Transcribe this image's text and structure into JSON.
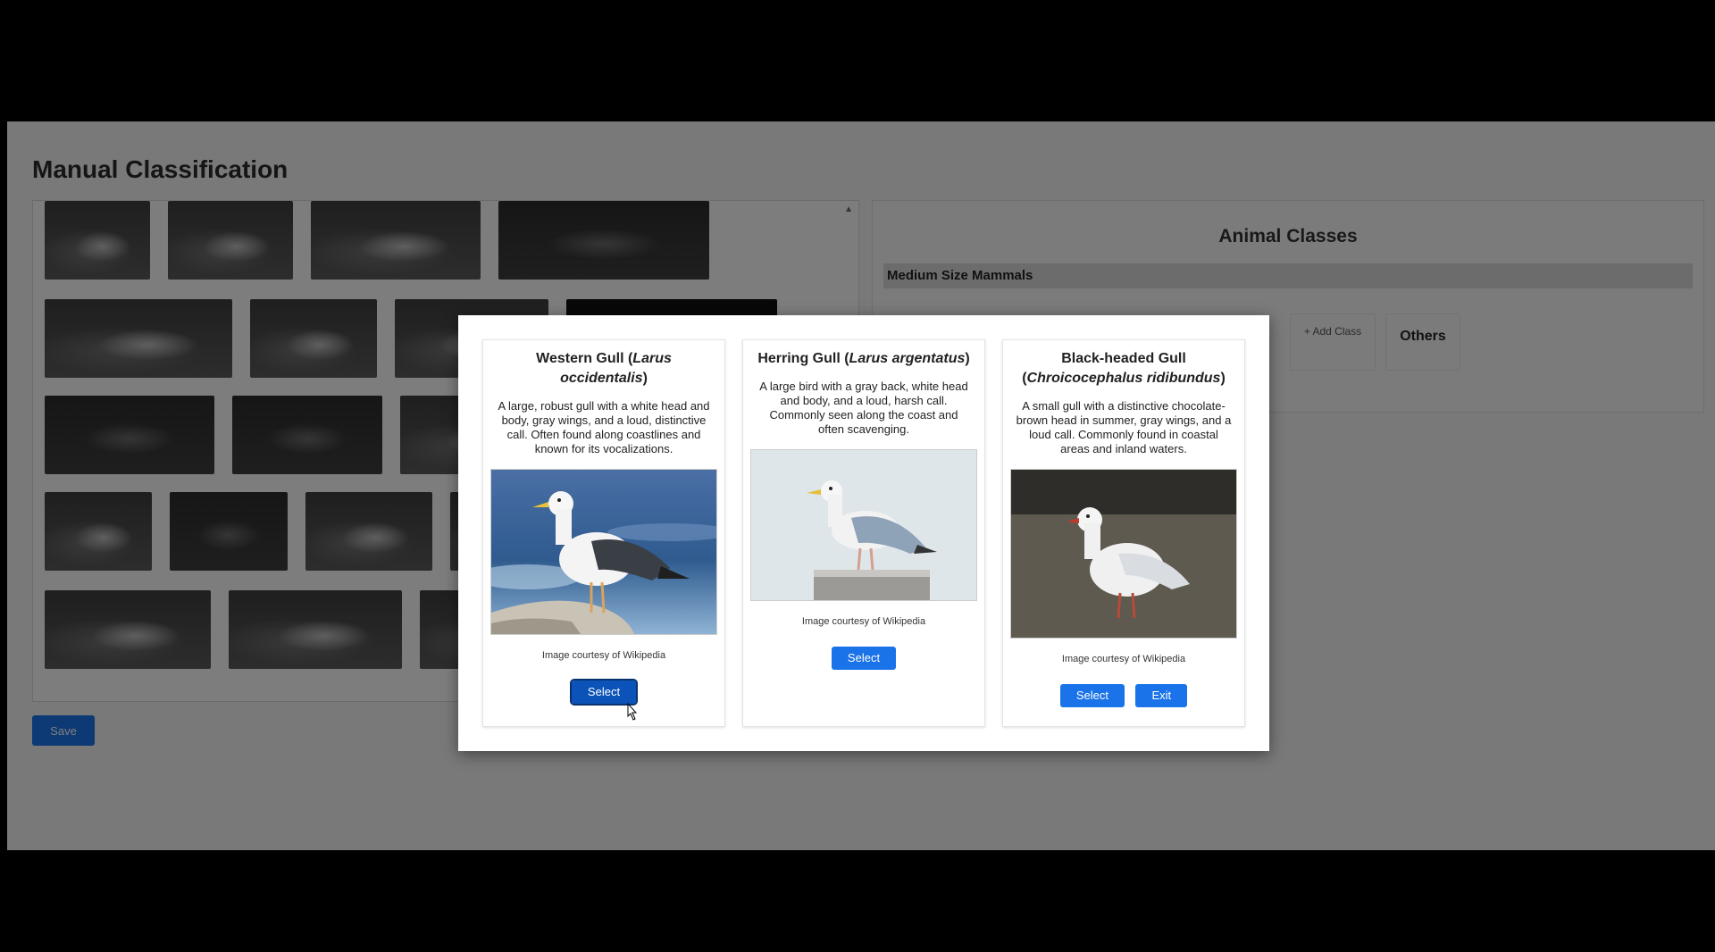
{
  "page": {
    "title": "Manual Classification",
    "save_label": "Save"
  },
  "animal_classes": {
    "title": "Animal Classes",
    "category": "Medium Size Mammals",
    "add_class": "+ Add Class",
    "others": "Others"
  },
  "modal": {
    "cards": [
      {
        "name_common": "Western Gull (",
        "name_sci": "Larus occidentalis",
        "name_close": ")",
        "description": "A large, robust gull with a white head and body, gray wings, and a loud, distinctive call. Often found along coastlines and known for its vocalizations.",
        "caption": "Image courtesy of Wikipedia",
        "select_label": "Select"
      },
      {
        "name_common": "Herring Gull (",
        "name_sci": "Larus argentatus",
        "name_close": ")",
        "description": "A large bird with a gray back, white head and body, and a loud, harsh call. Commonly seen along the coast and often scavenging.",
        "caption": "Image courtesy of Wikipedia",
        "select_label": "Select"
      },
      {
        "name_common": "Black-headed Gull (",
        "name_sci": "Chroicocephalus ridibundus",
        "name_close": ")",
        "description": "A small gull with a distinctive chocolate-brown head in summer, gray wings, and a loud call. Commonly found in coastal areas and inland waters.",
        "caption": "Image courtesy of Wikipedia",
        "select_label": "Select",
        "exit_label": "Exit"
      }
    ]
  },
  "colors": {
    "primary_button": "#1a73e8",
    "overlay": "rgba(0,0,0,0.5)"
  }
}
